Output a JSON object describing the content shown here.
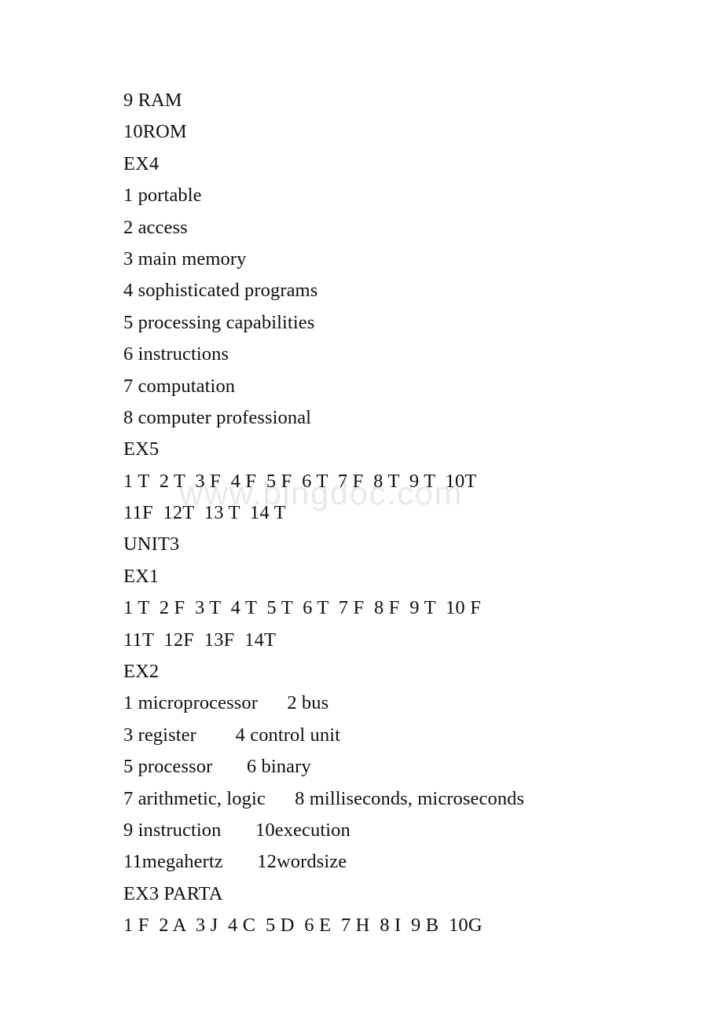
{
  "document": {
    "watermark": "www.bingdoc.com",
    "lines": [
      {
        "id": "line-9-ram",
        "text": "9 RAM"
      },
      {
        "id": "line-10-rom",
        "text": "10ROM"
      },
      {
        "id": "heading-ex4",
        "text": "EX4"
      },
      {
        "id": "ex4-1",
        "text": "1 portable"
      },
      {
        "id": "ex4-2",
        "text": "2 access"
      },
      {
        "id": "ex4-3",
        "text": "3 main memory"
      },
      {
        "id": "ex4-4",
        "text": "4 sophisticated programs"
      },
      {
        "id": "ex4-5",
        "text": "5 processing capabilities"
      },
      {
        "id": "ex4-6",
        "text": "6 instructions"
      },
      {
        "id": "ex4-7",
        "text": "7 computation"
      },
      {
        "id": "ex4-8",
        "text": "8 computer professional"
      },
      {
        "id": "heading-ex5",
        "text": "EX5"
      },
      {
        "id": "ex5-answers-1",
        "text": "1 T  2 T  3 F  4 F  5 F  6 T  7 F  8 T  9 T  10T"
      },
      {
        "id": "ex5-answers-2",
        "text": "11F  12T  13 T  14 T"
      },
      {
        "id": "heading-unit3",
        "text": "UNIT3"
      },
      {
        "id": "heading-ex1",
        "text": "EX1"
      },
      {
        "id": "ex1-answers-1",
        "text": "1 T  2 F  3 T  4 T  5 T  6 T  7 F  8 F  9 T  10 F"
      },
      {
        "id": "ex1-answers-2",
        "text": "11T  12F  13F  14T"
      },
      {
        "id": "heading-ex2",
        "text": "EX2"
      },
      {
        "id": "ex2-row-1",
        "text": "1 microprocessor      2 bus"
      },
      {
        "id": "ex2-row-2",
        "text": "3 register        4 control unit"
      },
      {
        "id": "ex2-row-3",
        "text": "5 processor       6 binary"
      },
      {
        "id": "ex2-row-4",
        "text": "7 arithmetic, logic      8 milliseconds, microseconds"
      },
      {
        "id": "ex2-row-5",
        "text": "9 instruction       10execution"
      },
      {
        "id": "ex2-row-6",
        "text": "11megahertz       12wordsize"
      },
      {
        "id": "heading-ex3-parta",
        "text": "EX3 PARTA"
      },
      {
        "id": "ex3-answers",
        "text": "1 F  2 A  3 J  4 C  5 D  6 E  7 H  8 I  9 B  10G"
      }
    ]
  }
}
